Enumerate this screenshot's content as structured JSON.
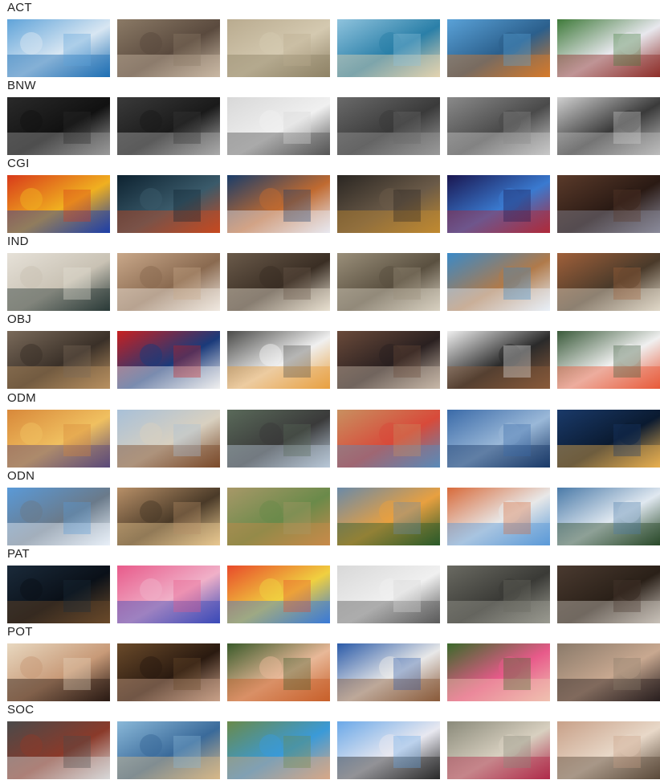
{
  "categories": [
    {
      "label": "ACT",
      "images": [
        {
          "name": "hurdle-race-thumb",
          "colors": [
            "#5fa3d9",
            "#1f6fb3",
            "#d8e6f2"
          ]
        },
        {
          "name": "bridge-runners-thumb",
          "colors": [
            "#8b7a66",
            "#c9b8a3",
            "#5a4a3e"
          ]
        },
        {
          "name": "soldiers-rocks-thumb",
          "colors": [
            "#b9ab8f",
            "#8f8266",
            "#d4c9b0"
          ]
        },
        {
          "name": "beach-jump-thumb",
          "colors": [
            "#8fc3dd",
            "#e3d3b0",
            "#2a7fa8"
          ]
        },
        {
          "name": "carousel-swing-thumb",
          "colors": [
            "#5aa2d8",
            "#d67a2a",
            "#2b5f8c"
          ]
        },
        {
          "name": "baseball-dive-thumb",
          "colors": [
            "#3f7a3a",
            "#8e2f2a",
            "#e8e8ee"
          ]
        }
      ]
    },
    {
      "label": "BNW",
      "images": [
        {
          "name": "tunnel-lights-thumb",
          "colors": [
            "#2a2a2a",
            "#9a9a9a",
            "#111111"
          ]
        },
        {
          "name": "city-skyline-bw-thumb",
          "colors": [
            "#3a3a3a",
            "#aaaaaa",
            "#1a1a1a"
          ]
        },
        {
          "name": "wedding-couple-bw-thumb",
          "colors": [
            "#d8d8d8",
            "#555555",
            "#f0f0f0"
          ]
        },
        {
          "name": "children-field-bw-thumb",
          "colors": [
            "#6a6a6a",
            "#9a9a9a",
            "#3a3a3a"
          ]
        },
        {
          "name": "misty-forest-bw-thumb",
          "colors": [
            "#8a8a8a",
            "#c8c8c8",
            "#4a4a4a"
          ]
        },
        {
          "name": "pyramids-reflection-bw-thumb",
          "colors": [
            "#d0d0d0",
            "#bcbcbc",
            "#3a3a3a"
          ]
        }
      ]
    },
    {
      "label": "CGI",
      "images": [
        {
          "name": "sonic-game-thumb",
          "colors": [
            "#d83a1a",
            "#1d3fa8",
            "#f0b020"
          ]
        },
        {
          "name": "soldier-game-thumb",
          "colors": [
            "#0d2230",
            "#c84a20",
            "#3a5a6a"
          ]
        },
        {
          "name": "marshmallow-man-thumb",
          "colors": [
            "#1a3d6a",
            "#e8e8f0",
            "#c06a30"
          ]
        },
        {
          "name": "armored-hero-thumb",
          "colors": [
            "#2a2622",
            "#c08a30",
            "#6a5a48"
          ]
        },
        {
          "name": "shovel-knight-thumb",
          "colors": [
            "#1a1650",
            "#b02a3a",
            "#3a7ad0"
          ]
        },
        {
          "name": "mech-battle-thumb",
          "colors": [
            "#5a3a2a",
            "#8a8a9a",
            "#2a1a14"
          ]
        }
      ]
    },
    {
      "label": "IND",
      "images": [
        {
          "name": "leather-sofa-room-thumb",
          "colors": [
            "#e6e1d8",
            "#2a3a38",
            "#c9c2b4"
          ]
        },
        {
          "name": "banquet-hall-thumb",
          "colors": [
            "#c9a88a",
            "#f0e8e0",
            "#8a6a50"
          ]
        },
        {
          "name": "cafe-interior-thumb",
          "colors": [
            "#6a5a4a",
            "#e8e0d0",
            "#3a2e24"
          ]
        },
        {
          "name": "train-carriage-thumb",
          "colors": [
            "#9a8f7a",
            "#d8d0c0",
            "#5a5040"
          ]
        },
        {
          "name": "glass-roof-library-thumb",
          "colors": [
            "#3a8ac8",
            "#e8f0f8",
            "#b07a4a"
          ]
        },
        {
          "name": "reading-room-thumb",
          "colors": [
            "#a0603a",
            "#e0d8c8",
            "#4a3a2a"
          ]
        }
      ]
    },
    {
      "label": "OBJ",
      "images": [
        {
          "name": "hat-flatlay-thumb",
          "colors": [
            "#7a6a5a",
            "#b89060",
            "#3a3028"
          ]
        },
        {
          "name": "flag-shelf-thumb",
          "colors": [
            "#c82020",
            "#f0f0f0",
            "#1a3a7a"
          ]
        },
        {
          "name": "phone-earbuds-thumb",
          "colors": [
            "#4a4a48",
            "#e8a040",
            "#f0f0f0"
          ]
        },
        {
          "name": "espresso-machine-thumb",
          "colors": [
            "#6a4a3a",
            "#c8b8a8",
            "#2a2020"
          ]
        },
        {
          "name": "desk-speakers-thumb",
          "colors": [
            "#f0f0f0",
            "#8a5a3a",
            "#2a2a2a"
          ]
        },
        {
          "name": "hot-air-balloon-thumb",
          "colors": [
            "#3a5a3a",
            "#e85a3a",
            "#f0f0f0"
          ]
        }
      ]
    },
    {
      "label": "ODM",
      "images": [
        {
          "name": "city-sunset-aerial-thumb",
          "colors": [
            "#d8883a",
            "#5a4a7a",
            "#f0c060"
          ]
        },
        {
          "name": "wind-turbines-thumb",
          "colors": [
            "#a8c0d8",
            "#7a4a2a",
            "#d8d0c0"
          ]
        },
        {
          "name": "vintage-beetle-thumb",
          "colors": [
            "#5a6a5a",
            "#b8c8d8",
            "#3a3a3a"
          ]
        },
        {
          "name": "colorful-harbor-thumb",
          "colors": [
            "#c89060",
            "#5a8ab8",
            "#d84a3a"
          ]
        },
        {
          "name": "glass-towers-thumb",
          "colors": [
            "#3a6aa8",
            "#1a3a68",
            "#9ab8d8"
          ]
        },
        {
          "name": "night-skyline-thumb",
          "colors": [
            "#1a3a6a",
            "#e8b050",
            "#0a1a30"
          ]
        }
      ]
    },
    {
      "label": "ODN",
      "images": [
        {
          "name": "mountain-lake-thumb",
          "colors": [
            "#5a9ad8",
            "#e8f0f8",
            "#6a7a8a"
          ]
        },
        {
          "name": "foggy-tree-thumb",
          "colors": [
            "#b89068",
            "#e8c890",
            "#4a3a28"
          ]
        },
        {
          "name": "antelope-savanna-thumb",
          "colors": [
            "#a89868",
            "#c88a4a",
            "#6a8a4a"
          ]
        },
        {
          "name": "rainbow-forest-thumb",
          "colors": [
            "#6a8aa8",
            "#2a5a2a",
            "#e8a040"
          ]
        },
        {
          "name": "rock-arch-thumb",
          "colors": [
            "#d86a3a",
            "#5a9ad8",
            "#e8e8e8"
          ]
        },
        {
          "name": "alpine-lake-thumb",
          "colors": [
            "#4a7aa8",
            "#2a4a2a",
            "#e0e8f0"
          ]
        }
      ]
    },
    {
      "label": "PAT",
      "images": [
        {
          "name": "pipes-pattern-thumb",
          "colors": [
            "#1a2a3a",
            "#6a4a2a",
            "#0a1018"
          ]
        },
        {
          "name": "pink-facade-thumb",
          "colors": [
            "#e85a8a",
            "#3a4ab8",
            "#f0b0c8"
          ]
        },
        {
          "name": "painted-eggs-thumb",
          "colors": [
            "#e84a2a",
            "#3a7ad8",
            "#f0d040"
          ]
        },
        {
          "name": "white-vases-thumb",
          "colors": [
            "#d8d8d8",
            "#5a5a5a",
            "#f0f0f0"
          ]
        },
        {
          "name": "grid-windows-thumb",
          "colors": [
            "#6a6a62",
            "#9a9a90",
            "#3a3a36"
          ]
        },
        {
          "name": "clay-jars-thumb",
          "colors": [
            "#4a3a30",
            "#c8c0b8",
            "#2a2018"
          ]
        }
      ]
    },
    {
      "label": "POT",
      "images": [
        {
          "name": "woman-sunhat-thumb",
          "colors": [
            "#e8d8c0",
            "#2a1a14",
            "#c89a78"
          ]
        },
        {
          "name": "bearded-man-thumb",
          "colors": [
            "#6a4a2a",
            "#c8a088",
            "#2a1a10"
          ]
        },
        {
          "name": "red-haired-boy-thumb",
          "colors": [
            "#3a5a2a",
            "#c8602a",
            "#e8b898"
          ]
        },
        {
          "name": "elderly-man-hat-thumb",
          "colors": [
            "#2a5aa8",
            "#8a5a3a",
            "#e8e8e8"
          ]
        },
        {
          "name": "girl-flower-crown-thumb",
          "colors": [
            "#3a6a2a",
            "#f0c0b0",
            "#e85a8a"
          ]
        },
        {
          "name": "girl-glasses-thumb",
          "colors": [
            "#8a7a6a",
            "#2a2020",
            "#c8a890"
          ]
        }
      ]
    },
    {
      "label": "SOC",
      "images": [
        {
          "name": "office-crowd-thumb",
          "colors": [
            "#4a4a4a",
            "#d8d8d8",
            "#8a3a2a"
          ]
        },
        {
          "name": "crowded-beach-thumb",
          "colors": [
            "#8ab8d8",
            "#d8b888",
            "#3a6a9a"
          ]
        },
        {
          "name": "water-fight-thumb",
          "colors": [
            "#6a8a4a",
            "#d8a888",
            "#3a9ad8"
          ]
        },
        {
          "name": "swing-ride-thumb",
          "colors": [
            "#6aa8e8",
            "#2a2a2a",
            "#e8e8f0"
          ]
        },
        {
          "name": "school-girls-thumb",
          "colors": [
            "#8a8a7a",
            "#b02a4a",
            "#d8d0c0"
          ]
        },
        {
          "name": "group-selfie-thumb",
          "colors": [
            "#c8a088",
            "#5a4a3a",
            "#e8d8c8"
          ]
        }
      ]
    }
  ]
}
